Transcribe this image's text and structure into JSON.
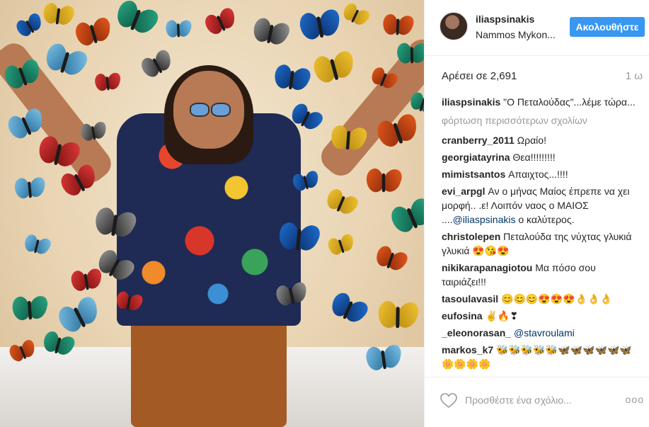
{
  "header": {
    "username": "iliaspsinakis",
    "location": "Nammos Mykon...",
    "follow_label": "Ακολουθήστε"
  },
  "likes": "Αρέσει σε 2,691",
  "time_ago": "1 ω",
  "caption": {
    "user": "iliaspsinakis",
    "text": "\"Ο Πεταλούδας\"...λέμε τώρα..."
  },
  "load_more": "φόρτωση περισσότερων σχολίων",
  "comments": [
    {
      "user": "cranberry_2011",
      "text": "Ωραίο!"
    },
    {
      "user": "georgiatayrina",
      "text": "Θεα!!!!!!!!!"
    },
    {
      "user": "mimistsantos",
      "text": "Απαιχτος...!!!!"
    },
    {
      "user": "evi_arpgl",
      "text": "Αν ο μήνας Μαίος έπρεπε να χει μορφή.. .ε! Λοιπόν ναος ο ΜΑΙΟΣ ....",
      "mention": "@iliaspsinakis",
      "after": " ο καλύτερος."
    },
    {
      "user": "christolepen",
      "text": "Πεταλούδα της νύχτας γλυκιά γλυκιά 😍😘😍"
    },
    {
      "user": "nikikarapanagiotou",
      "text": "Μα πόσο σου ταιριάζει!!!"
    },
    {
      "user": "tasoulavasil",
      "text": "😊😊😊😍😍😍👌👌👌"
    },
    {
      "user": "eufosina",
      "text": "✌🔥❣"
    },
    {
      "user": "_eleonorasan_",
      "text": "",
      "mention": "@stavroulami",
      "after": ""
    },
    {
      "user": "markos_k7",
      "text": "🐝🐝🐝🐝🐝🦋🦋🦋🦋🦋🦋🌼🌼🌼🌼"
    }
  ],
  "add_comment_placeholder": "Προσθέστε ένα σχόλιο...",
  "more_dots": "ooo"
}
